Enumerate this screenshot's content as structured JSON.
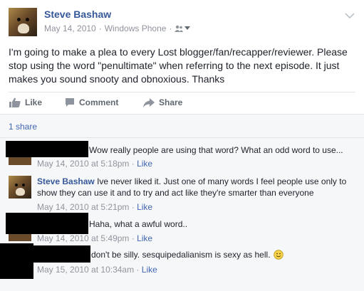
{
  "post": {
    "author": "Steve Bashaw",
    "date": "May 14, 2010",
    "source": "Windows Phone",
    "separator": "·",
    "text": "I'm going to make a plea to every Lost blogger/fan/recapper/reviewer. Please stop using the word \"penultimate\" when referring to the next episode. It just makes you sound snooty and obnoxious. Thanks"
  },
  "actions": {
    "like": "Like",
    "comment": "Comment",
    "share": "Share"
  },
  "shares": "1 share",
  "comments": [
    {
      "author": "",
      "text": "Wow really people are using that word? What an odd word to use...",
      "time": "May 14, 2010 at 5:18pm",
      "link": "Like"
    },
    {
      "author": "Steve Bashaw",
      "text": "Ive never liked it. Just one of many words I feel people use only to show they can use it and to try and act like they're smarter than everyone",
      "time": "May 14, 2010 at 5:21pm",
      "link": "Like"
    },
    {
      "author": "",
      "text": "Haha, what a awful word..",
      "time": "May 14, 2010 at 5:49pm",
      "link": "Like"
    },
    {
      "author": "",
      "text": "don't be silly. sesquipedalianism is sexy as hell.",
      "time": "May 15, 2010 at 10:34am",
      "link": "Like"
    }
  ],
  "icons": {
    "chevron": "chevron-down-icon",
    "audience": "friends-icon",
    "like": "thumbs-up-icon",
    "comment": "speech-bubble-icon",
    "share": "share-arrow-icon",
    "emoji": "smiley-icon"
  }
}
